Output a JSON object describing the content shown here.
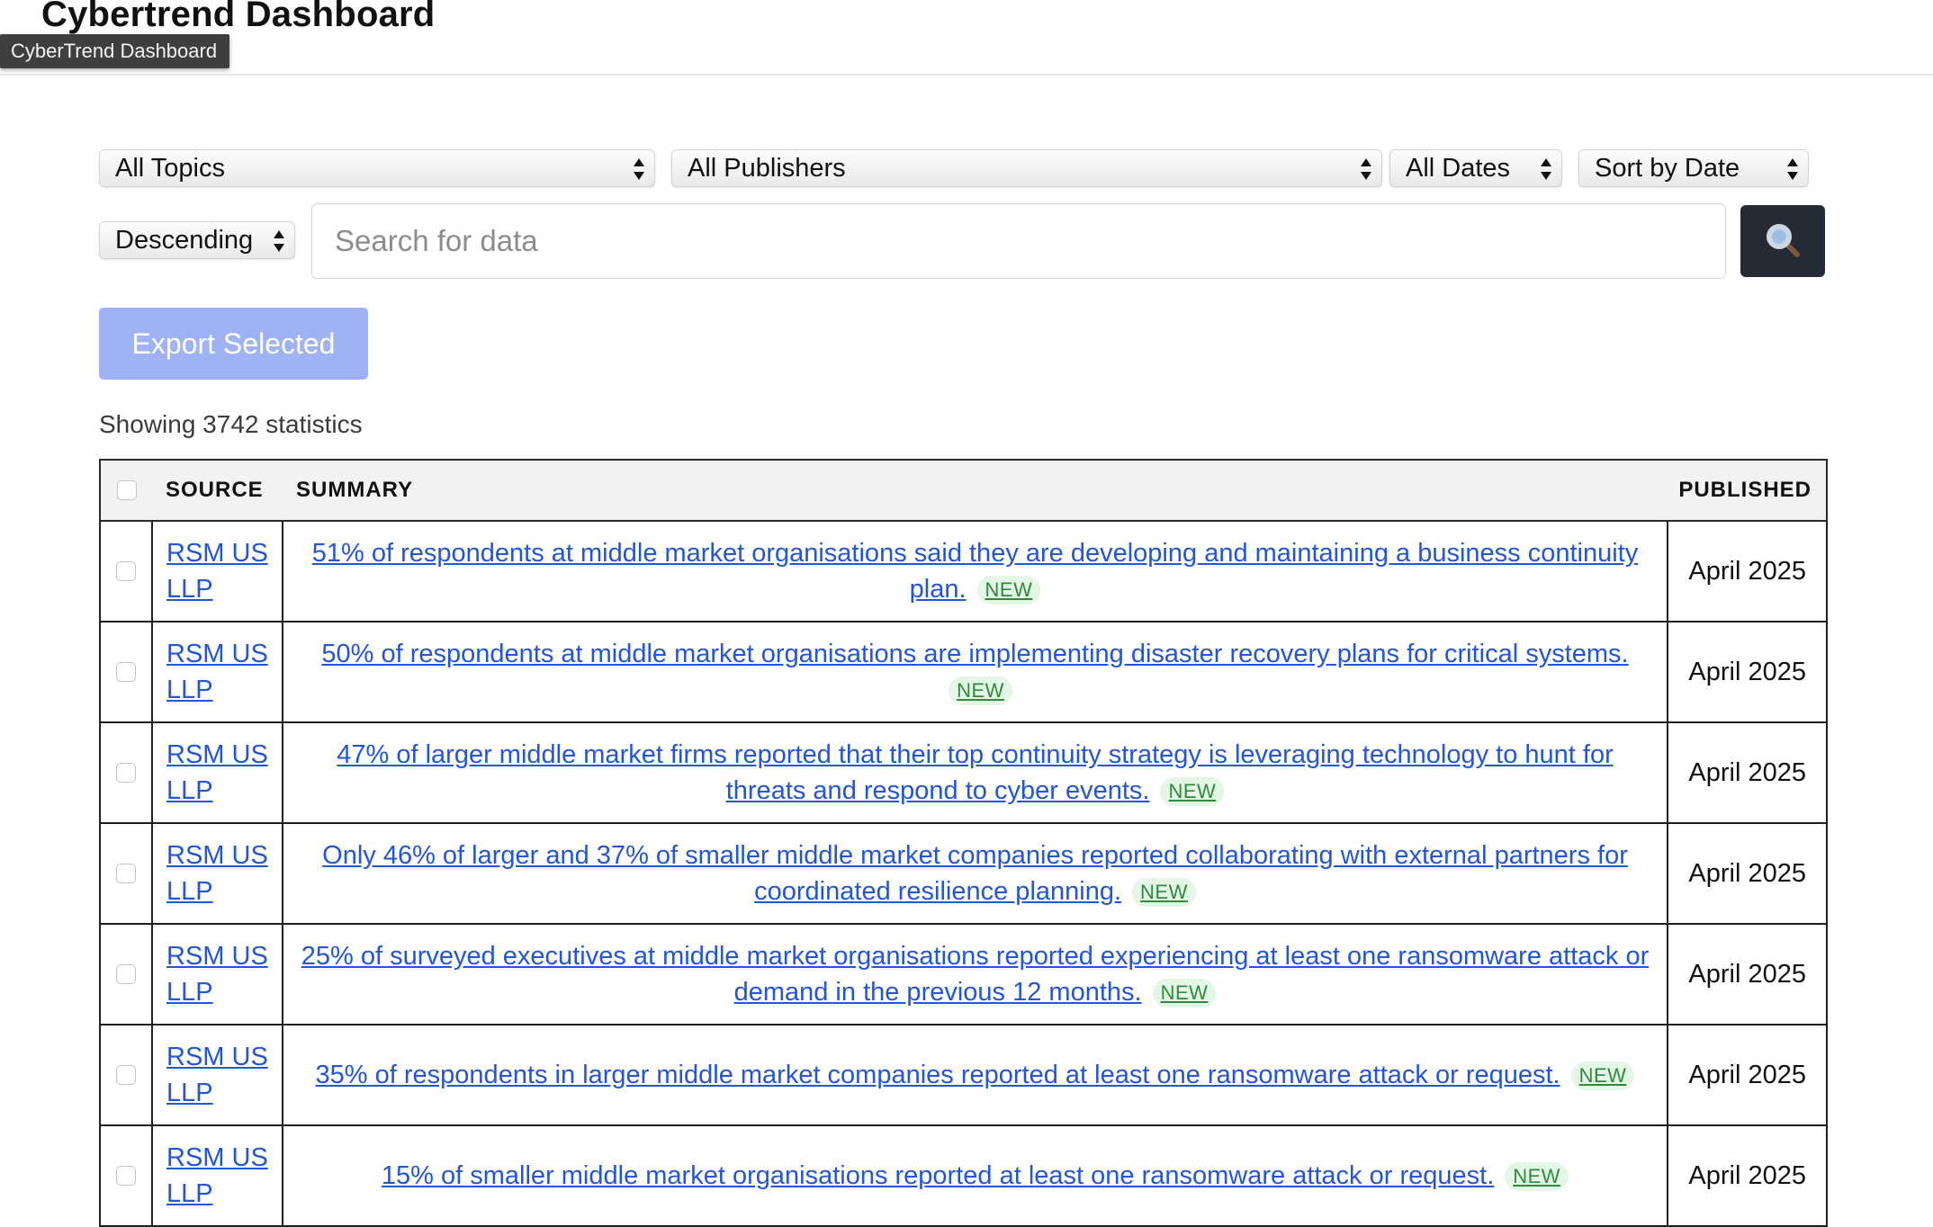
{
  "header": {
    "title": "Cybertrend Dashboard",
    "tooltip": "CyberTrend Dashboard"
  },
  "filters": {
    "topics": "All Topics",
    "publishers": "All Publishers",
    "dates": "All Dates",
    "sort_by": "Sort by Date",
    "order": "Descending"
  },
  "search": {
    "placeholder": "Search for data",
    "value": ""
  },
  "actions": {
    "export_label": "Export Selected"
  },
  "results": {
    "count_text": "Showing 3742 statistics"
  },
  "table": {
    "headers": {
      "source": "SOURCE",
      "summary": "SUMMARY",
      "published": "PUBLISHED"
    },
    "rows": [
      {
        "source": "RSM US LLP",
        "summary": "51% of respondents at middle market organisations said they are developing and maintaining a business continuity plan.",
        "badge": "NEW",
        "published": "April 2025"
      },
      {
        "source": "RSM US LLP",
        "summary": "50% of respondents at middle market organisations are implementing disaster recovery plans for critical systems.",
        "badge": "NEW",
        "published": "April 2025"
      },
      {
        "source": "RSM US LLP",
        "summary": "47% of larger middle market firms reported that their top continuity strategy is leveraging technology to hunt for threats and respond to cyber events.",
        "badge": "NEW",
        "published": "April 2025"
      },
      {
        "source": "RSM US LLP",
        "summary": "Only 46% of larger and 37% of smaller middle market companies reported collaborating with external partners for coordinated resilience planning.",
        "badge": "NEW",
        "published": "April 2025"
      },
      {
        "source": "RSM US LLP",
        "summary": "25% of surveyed executives at middle market organisations reported experiencing at least one ransomware attack or demand in the previous 12 months.",
        "badge": "NEW",
        "published": "April 2025"
      },
      {
        "source": "RSM US LLP",
        "summary": "35% of respondents in larger middle market companies reported at least one ransomware attack or request.",
        "badge": "NEW",
        "published": "April 2025"
      },
      {
        "source": "RSM US LLP",
        "summary": "15% of smaller middle market organisations reported at least one ransomware attack or request.",
        "badge": "NEW",
        "published": "April 2025"
      }
    ]
  }
}
